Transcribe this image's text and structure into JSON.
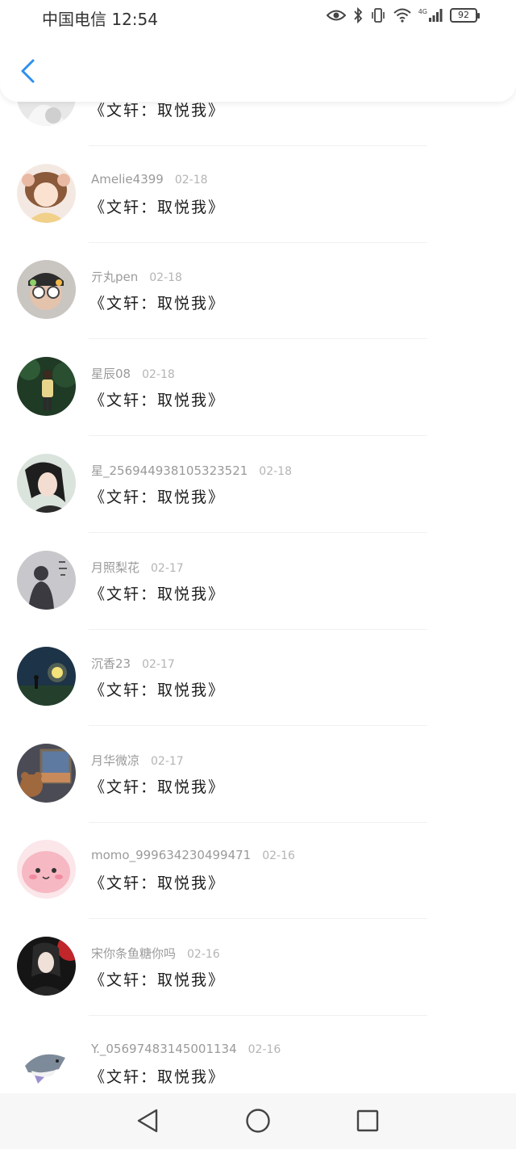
{
  "status_bar": {
    "carrier": "中国电信",
    "time": "12:54",
    "network": "4G",
    "battery": "92",
    "icons": [
      "eye-icon",
      "bluetooth-icon",
      "vibrate-icon",
      "wifi-icon",
      "signal-icon",
      "battery-icon"
    ]
  },
  "header": {
    "back_icon": "chevron-left-icon"
  },
  "comments": [
    {
      "name": "",
      "date": "",
      "text": "《文轩：取悦我》",
      "avatar": "avatar-partial"
    },
    {
      "name": "Amelie4399",
      "date": "02-18",
      "text": "《文轩：取悦我》",
      "avatar": "anime-girl"
    },
    {
      "name": "亓丸pen",
      "date": "02-18",
      "text": "《文轩：取悦我》",
      "avatar": "boy-glasses"
    },
    {
      "name": "星辰08",
      "date": "02-18",
      "text": "《文轩：取悦我》",
      "avatar": "person-forest"
    },
    {
      "name": "星_2569449381053235​21",
      "date": "02-18",
      "text": "《文轩：取悦我》",
      "avatar": "girl-portrait"
    },
    {
      "name": "月照梨花",
      "date": "02-17",
      "text": "《文轩：取悦我》",
      "avatar": "silhouette"
    },
    {
      "name": "沉香23",
      "date": "02-17",
      "text": "《文轩：取悦我》",
      "avatar": "night-moon"
    },
    {
      "name": "月华微凉",
      "date": "02-17",
      "text": "《文轩：取悦我》",
      "avatar": "bear-window"
    },
    {
      "name": "momo_999634230499471",
      "date": "02-16",
      "text": "《文轩：取悦我》",
      "avatar": "pink-blob"
    },
    {
      "name": "宋你条鱼糖你吗",
      "date": "02-16",
      "text": "《文轩：取悦我》",
      "avatar": "dark-girl"
    },
    {
      "name": "Y._05697483145001134",
      "date": "02-16",
      "text": "《文轩：取悦我》",
      "avatar": "shark-toy"
    }
  ],
  "nav_bar": {
    "icons": [
      "back-triangle-icon",
      "home-circle-icon",
      "recents-square-icon"
    ]
  }
}
